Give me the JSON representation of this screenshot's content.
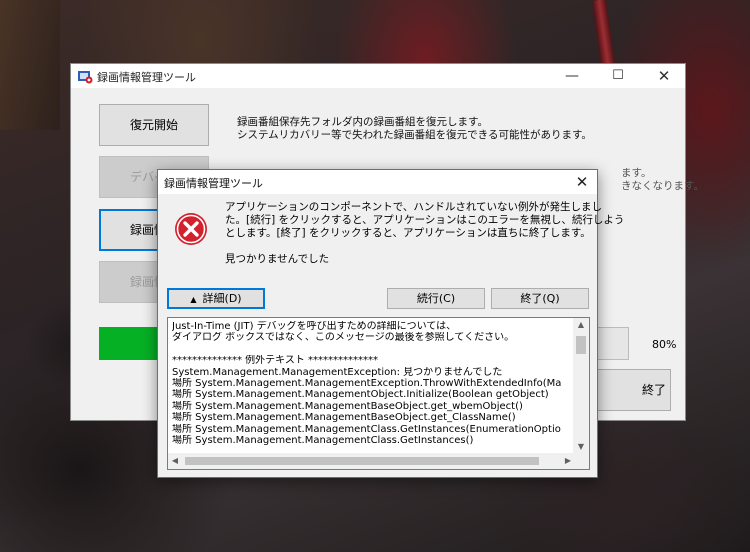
{
  "main_window": {
    "title": "録画情報管理ツール",
    "buttons": {
      "restore": "復元開始",
      "device": "デバイス",
      "info": "録画情報",
      "info2": "録画情報"
    },
    "desc_restore": [
      "録画番組保存先フォルダ内の録画番組を復元します。",
      "システムリカバリー等で失われた録画番組を復元できる可能性があります。"
    ],
    "desc_device": [
      "ます。",
      "きなくなります。"
    ],
    "progress_fraction": 0.8,
    "progress_text": "80%",
    "exit_label": "終了"
  },
  "dialog": {
    "title": "録画情報管理ツール",
    "close_glyph": "✕",
    "message": [
      "アプリケーションのコンポーネントで、ハンドルされていない例外が発生しまし",
      "た。[続行] をクリックすると、アプリケーションはこのエラーを無視し、続行しよう",
      "とします。[終了] をクリックすると、アプリケーションは直ちに終了します。"
    ],
    "sub_message": "見つかりませんでした",
    "buttons": {
      "details": "詳細(D)",
      "details_glyph": "▲",
      "continue": "続行(C)",
      "quit": "終了(Q)"
    },
    "details_lines": [
      "Just-In-Time (JIT) デバッグを呼び出すための詳細については、",
      "ダイアログ ボックスではなく、このメッセージの最後を参照してください。",
      "",
      "************** 例外テキスト **************",
      "System.Management.ManagementException: 見つかりませんでした",
      "   場所 System.Management.ManagementException.ThrowWithExtendedInfo(Ma",
      "   場所 System.Management.ManagementObject.Initialize(Boolean getObject)",
      "   場所 System.Management.ManagementBaseObject.get_wbemObject()",
      "   場所 System.Management.ManagementBaseObject.get_ClassName()",
      "   場所 System.Management.ManagementClass.GetInstances(EnumerationOptio",
      "   場所 System.Management.ManagementClass.GetInstances()"
    ]
  },
  "icons": {
    "app": "recorder-app-icon",
    "error": "error-x-icon"
  },
  "colors": {
    "progress": "#06b025",
    "focus": "#0078d7",
    "error_red": "#d2222d"
  }
}
